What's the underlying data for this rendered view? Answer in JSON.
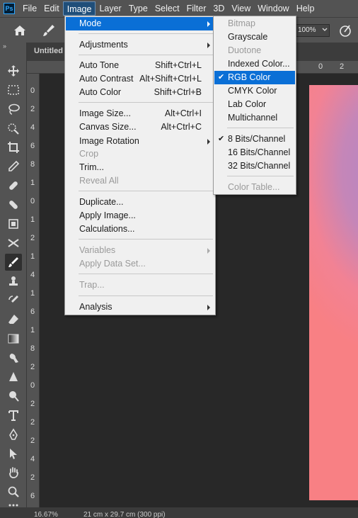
{
  "app": {
    "logo_text": "Ps"
  },
  "menubar": {
    "items": [
      "File",
      "Edit",
      "Image",
      "Layer",
      "Type",
      "Select",
      "Filter",
      "3D",
      "View",
      "Window",
      "Help"
    ]
  },
  "options": {
    "zoom_value": "100%"
  },
  "document": {
    "tab_label": "Untitled",
    "status_zoom": "16.67%",
    "status_size": "21 cm x 29.7 cm (300 ppi)"
  },
  "rulers": {
    "top": [
      "0",
      "2"
    ],
    "left": [
      "0",
      "2",
      "4",
      "6",
      "8",
      "1",
      "0",
      "1",
      "2",
      "1",
      "4",
      "1",
      "6",
      "1",
      "8",
      "2",
      "0",
      "2",
      "2",
      "2",
      "4",
      "2",
      "6"
    ]
  },
  "image_menu": {
    "items": [
      {
        "label": "Mode",
        "shortcut": "",
        "submenu": true,
        "state": "highlighted"
      },
      {
        "label": "Adjustments",
        "shortcut": "",
        "submenu": true,
        "state": "enabled"
      },
      {
        "label": "Auto Tone",
        "shortcut": "Shift+Ctrl+L",
        "submenu": false,
        "state": "enabled"
      },
      {
        "label": "Auto Contrast",
        "shortcut": "Alt+Shift+Ctrl+L",
        "submenu": false,
        "state": "enabled"
      },
      {
        "label": "Auto Color",
        "shortcut": "Shift+Ctrl+B",
        "submenu": false,
        "state": "enabled"
      },
      {
        "label": "Image Size...",
        "shortcut": "Alt+Ctrl+I",
        "submenu": false,
        "state": "enabled"
      },
      {
        "label": "Canvas Size...",
        "shortcut": "Alt+Ctrl+C",
        "submenu": false,
        "state": "enabled"
      },
      {
        "label": "Image Rotation",
        "shortcut": "",
        "submenu": true,
        "state": "enabled"
      },
      {
        "label": "Crop",
        "shortcut": "",
        "submenu": false,
        "state": "disabled"
      },
      {
        "label": "Trim...",
        "shortcut": "",
        "submenu": false,
        "state": "enabled"
      },
      {
        "label": "Reveal All",
        "shortcut": "",
        "submenu": false,
        "state": "disabled"
      },
      {
        "label": "Duplicate...",
        "shortcut": "",
        "submenu": false,
        "state": "enabled"
      },
      {
        "label": "Apply Image...",
        "shortcut": "",
        "submenu": false,
        "state": "enabled"
      },
      {
        "label": "Calculations...",
        "shortcut": "",
        "submenu": false,
        "state": "enabled"
      },
      {
        "label": "Variables",
        "shortcut": "",
        "submenu": true,
        "state": "disabled"
      },
      {
        "label": "Apply Data Set...",
        "shortcut": "",
        "submenu": false,
        "state": "disabled"
      },
      {
        "label": "Trap...",
        "shortcut": "",
        "submenu": false,
        "state": "disabled"
      },
      {
        "label": "Analysis",
        "shortcut": "",
        "submenu": true,
        "state": "enabled"
      }
    ]
  },
  "mode_menu": {
    "items": [
      {
        "label": "Bitmap",
        "checked": false,
        "state": "disabled"
      },
      {
        "label": "Grayscale",
        "checked": false,
        "state": "enabled"
      },
      {
        "label": "Duotone",
        "checked": false,
        "state": "disabled"
      },
      {
        "label": "Indexed Color...",
        "checked": false,
        "state": "enabled"
      },
      {
        "label": "RGB Color",
        "checked": true,
        "state": "highlighted"
      },
      {
        "label": "CMYK Color",
        "checked": false,
        "state": "enabled"
      },
      {
        "label": "Lab Color",
        "checked": false,
        "state": "enabled"
      },
      {
        "label": "Multichannel",
        "checked": false,
        "state": "enabled"
      },
      {
        "label": "8 Bits/Channel",
        "checked": true,
        "state": "enabled"
      },
      {
        "label": "16 Bits/Channel",
        "checked": false,
        "state": "enabled"
      },
      {
        "label": "32 Bits/Channel",
        "checked": false,
        "state": "enabled"
      },
      {
        "label": "Color Table...",
        "checked": false,
        "state": "disabled"
      }
    ]
  },
  "toolbar": {
    "tools": [
      "move-tool-icon",
      "marquee-tool-icon",
      "lasso-tool-icon",
      "quick-selection-tool-icon",
      "crop-tool-icon",
      "eyedropper-tool-icon",
      "spot-healing-tool-icon",
      "bandage-tool-icon",
      "patch-tool-icon",
      "content-aware-move-icon",
      "brush-tool-icon",
      "clone-stamp-tool-icon",
      "history-brush-tool-icon",
      "eraser-tool-icon",
      "gradient-tool-icon",
      "smudge-tool-icon",
      "sharpen-tool-icon",
      "dodge-tool-icon",
      "type-tool-icon",
      "pen-tool-icon",
      "path-selection-tool-icon",
      "hand-tool-icon",
      "zoom-tool-icon",
      "more-tools-icon"
    ]
  }
}
